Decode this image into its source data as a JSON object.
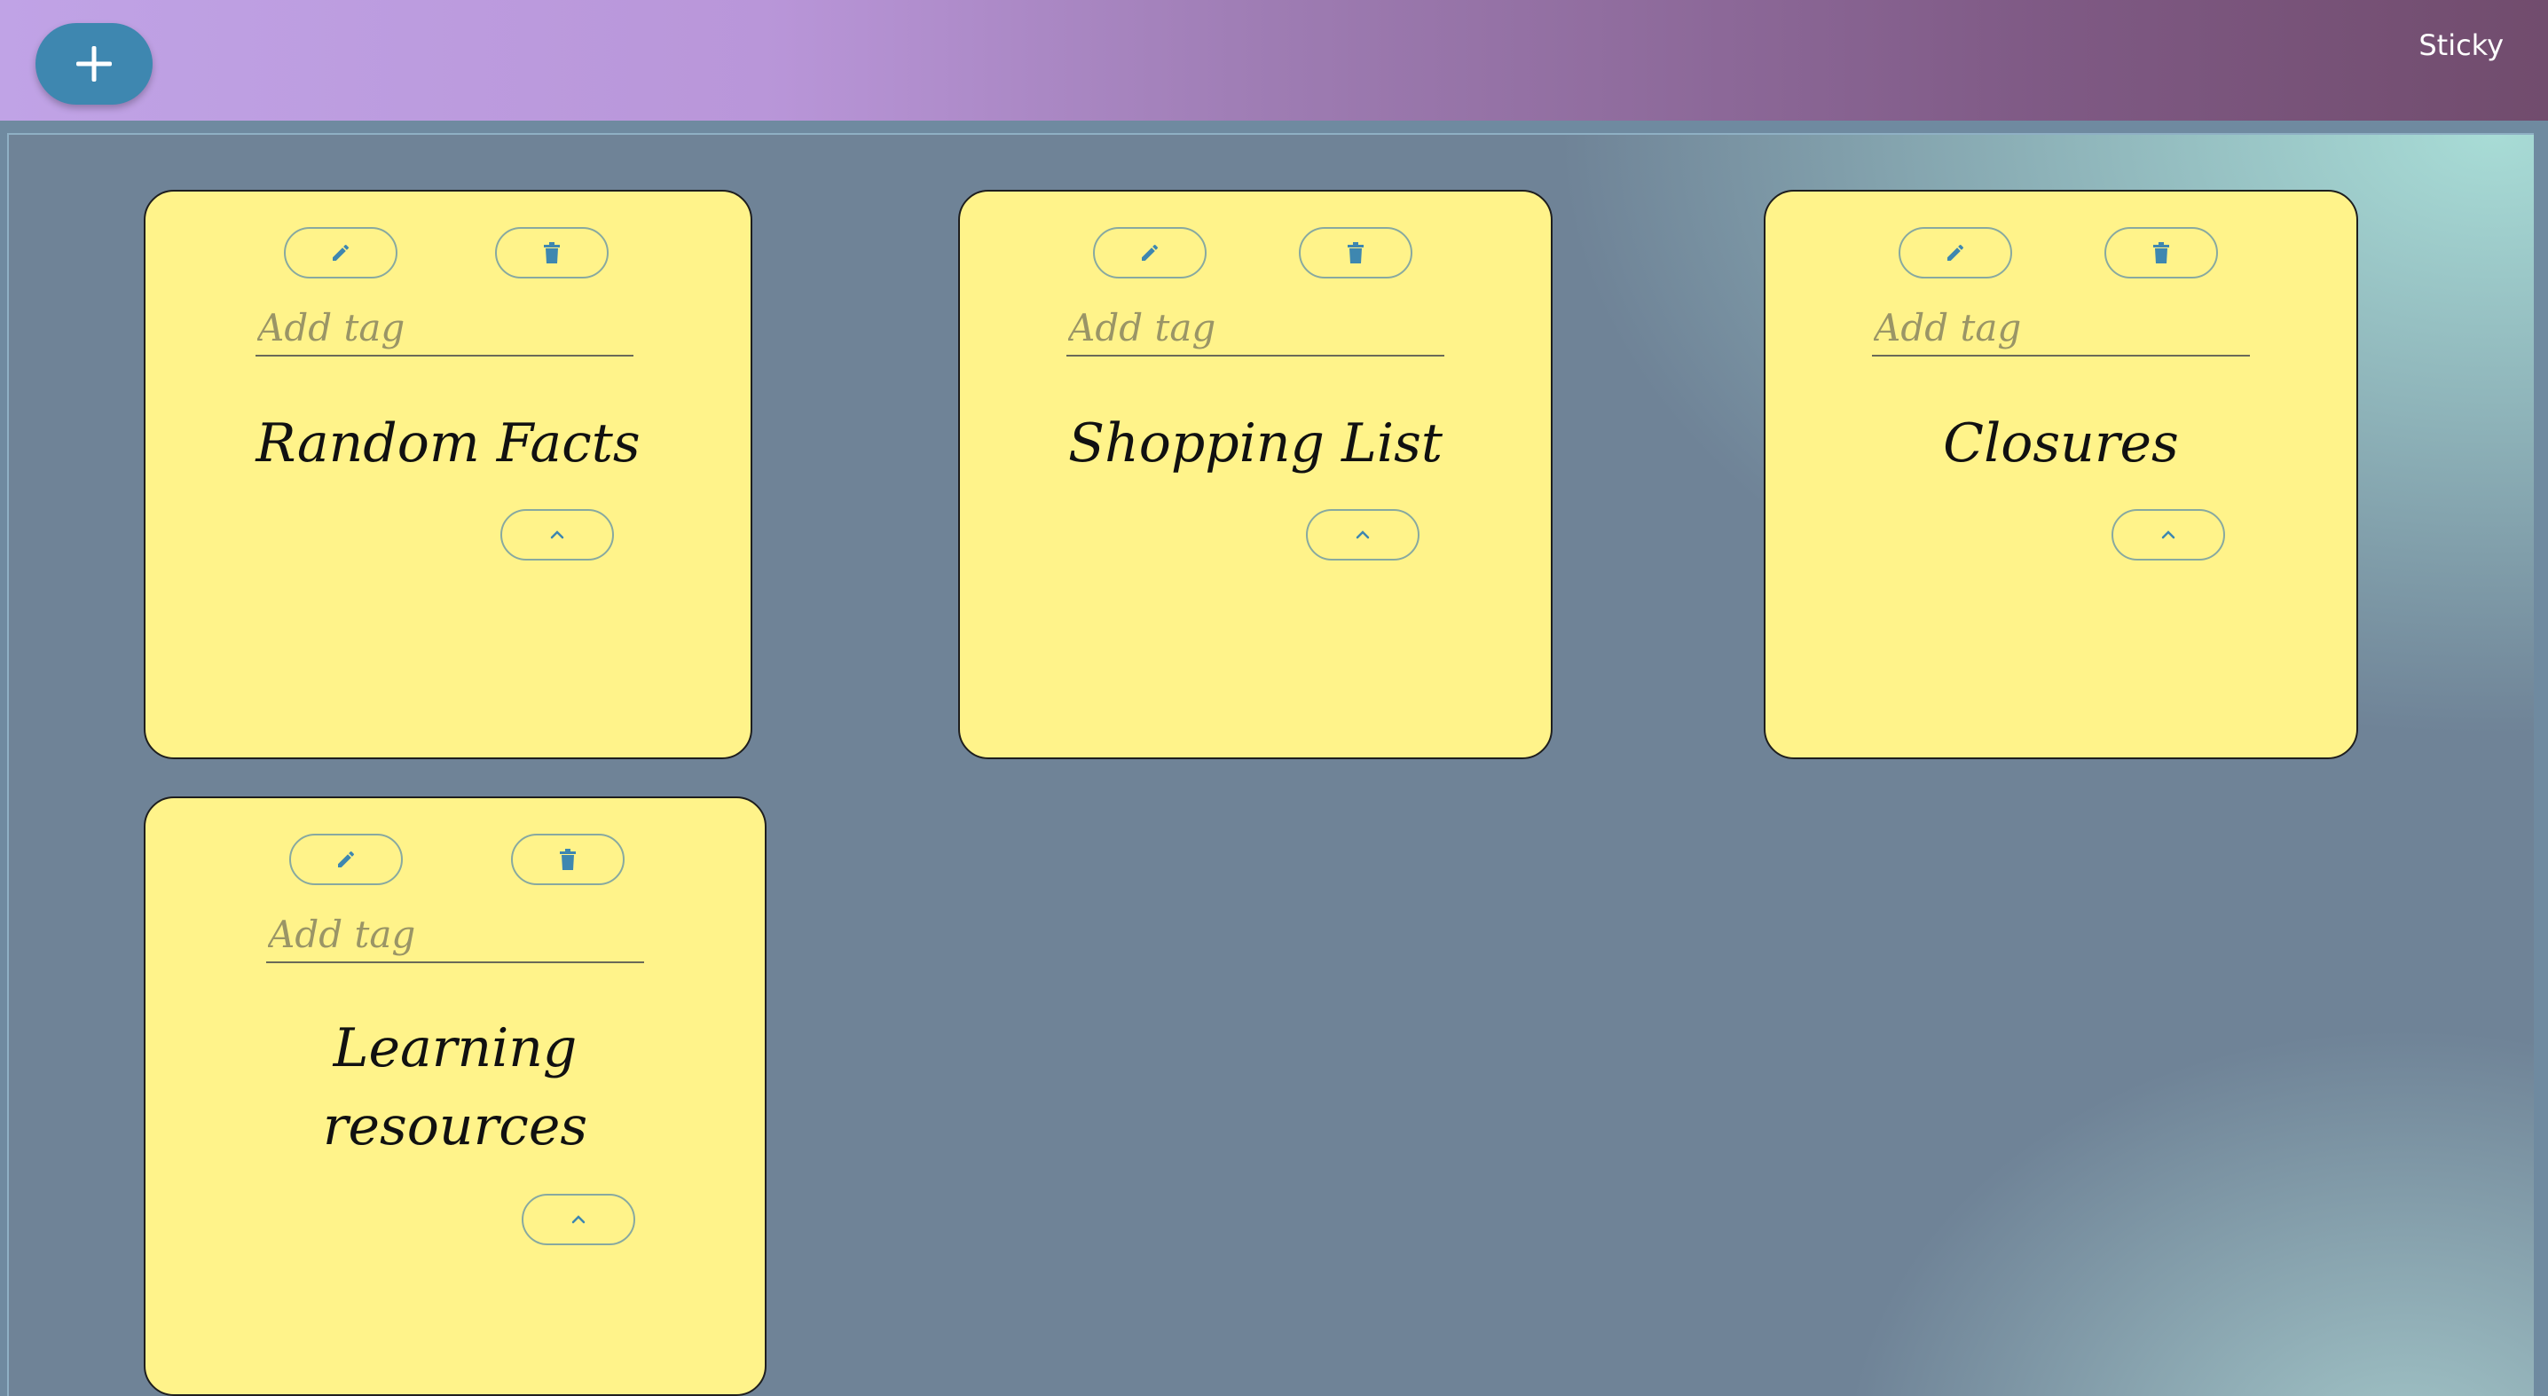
{
  "app": {
    "title": "Sticky",
    "add_button_label": "+"
  },
  "notes": [
    {
      "title": "Random Facts",
      "tag_placeholder": "Add tag",
      "tag_value": ""
    },
    {
      "title": "Shopping List",
      "tag_placeholder": "Add tag",
      "tag_value": ""
    },
    {
      "title": "Closures",
      "tag_placeholder": "Add tag",
      "tag_value": ""
    },
    {
      "title": "Learning resources",
      "tag_placeholder": "Add tag",
      "tag_value": ""
    }
  ],
  "icons": {
    "add": "plus-icon",
    "edit": "pencil-icon",
    "delete": "trash-icon",
    "collapse": "chevron-up-icon"
  },
  "colors": {
    "header_start": "#c0a3e6",
    "header_end": "#714c6d",
    "add_button": "#3e87b0",
    "note_background": "#fff38a",
    "icon_color": "#3e87b0",
    "board_background": "#6f8397"
  }
}
